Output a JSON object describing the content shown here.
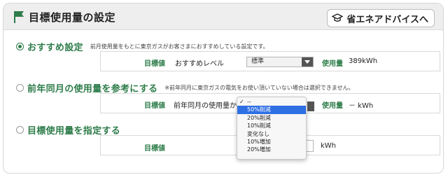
{
  "header": {
    "title": "目標使用量の設定",
    "flag_icon": "flag-icon",
    "advice_button": "省エネアドバイスへ",
    "advice_icon": "graduation-cap-icon",
    "accent_color": "#2e7d4a"
  },
  "options": [
    {
      "label": "おすすめ設定",
      "note": "前月使用量をもとに東京ガスがお客さまにおすすめしている設定です。",
      "checked": true,
      "target_label": "目標値",
      "field_label": "おすすめレベル",
      "select_value": "標準",
      "usage_label": "使用量",
      "usage_value": "389kWh"
    },
    {
      "label": "前年同月の使用量を参考にする",
      "note": "※前年同月に東京ガスの電気をお使い頂いていない場合は選択できません。",
      "checked": false,
      "target_label": "目標値",
      "field_label": "前年同月の使用量から",
      "usage_label": "使用量",
      "usage_value": "－ kWh"
    },
    {
      "label": "目標使用量を指定する",
      "checked": false,
      "target_label": "目標値",
      "unit": "kWh"
    }
  ],
  "dropdown": {
    "options": [
      "--",
      "50%削減",
      "20%削減",
      "10%削減",
      "変化なし",
      "10%増加",
      "20%増加"
    ],
    "selected": "--",
    "highlighted": "50%削減",
    "highlight_color": "#2f6fe4"
  }
}
